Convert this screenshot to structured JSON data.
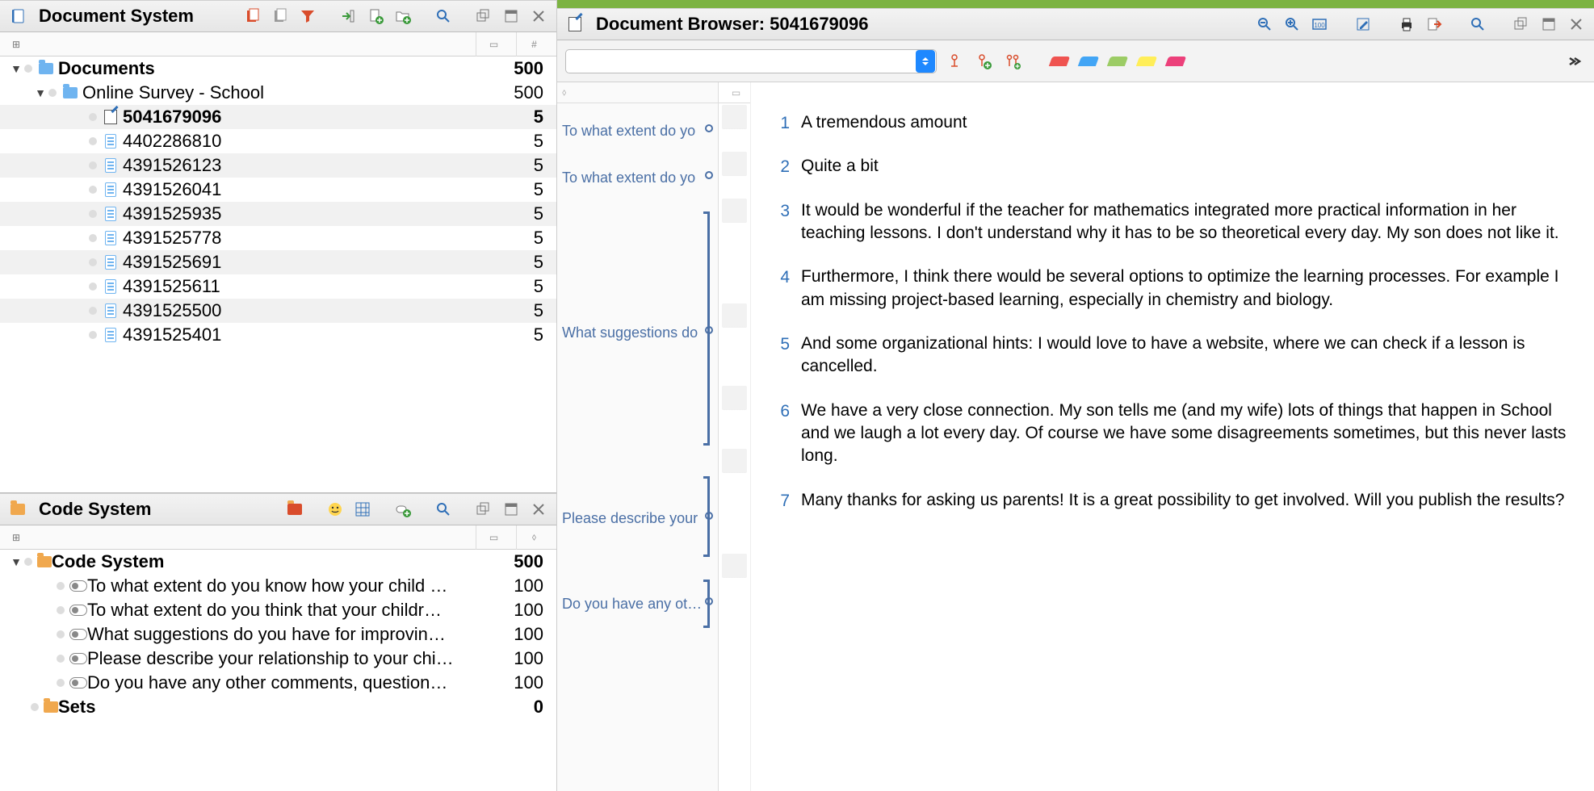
{
  "docSystem": {
    "title": "Document System",
    "root": {
      "label": "Documents",
      "count": "500"
    },
    "folder": {
      "label": "Online Survey - School",
      "count": "500"
    },
    "docs": [
      {
        "id": "5041679096",
        "count": "5",
        "selected": true
      },
      {
        "id": "4402286810",
        "count": "5"
      },
      {
        "id": "4391526123",
        "count": "5"
      },
      {
        "id": "4391526041",
        "count": "5"
      },
      {
        "id": "4391525935",
        "count": "5"
      },
      {
        "id": "4391525778",
        "count": "5"
      },
      {
        "id": "4391525691",
        "count": "5"
      },
      {
        "id": "4391525611",
        "count": "5"
      },
      {
        "id": "4391525500",
        "count": "5"
      },
      {
        "id": "4391525401",
        "count": "5"
      }
    ]
  },
  "codeSystem": {
    "title": "Code System",
    "root": {
      "label": "Code System",
      "count": "500"
    },
    "codes": [
      {
        "label": "To what extent do you know how your child …",
        "count": "100"
      },
      {
        "label": "To what extent do you think that your childr…",
        "count": "100"
      },
      {
        "label": "What suggestions do you have for improvin…",
        "count": "100"
      },
      {
        "label": "Please describe your relationship to your chi…",
        "count": "100"
      },
      {
        "label": "Do you have any other comments, question…",
        "count": "100"
      }
    ],
    "sets": {
      "label": "Sets",
      "count": "0"
    }
  },
  "browser": {
    "title": "Document Browser: 5041679096",
    "stripLabels": [
      "To what extent do yo",
      "To what extent do yo",
      "What suggestions do",
      "Please describe your",
      "Do you have any othe"
    ],
    "paragraphs": [
      {
        "n": "1",
        "text": "A tremendous amount"
      },
      {
        "n": "2",
        "text": "Quite a bit"
      },
      {
        "n": "3",
        "text": "It would be wonderful if the teacher for mathematics integrated more practical information in her teaching lessons. I don't understand why it has to be so theoretical every day. My son does not like it."
      },
      {
        "n": "4",
        "text": "Furthermore, I think there would be several options to optimize the learning processes. For example I am missing project-based learning, especially in chemistry and biology."
      },
      {
        "n": "5",
        "text": "And some organizational hints: I would love to have a website, where we can check if a lesson is cancelled."
      },
      {
        "n": "6",
        "text": "We have a very close connection. My son tells me (and my wife) lots of things that happen in School and we laugh a lot every day. Of course we have some disagreements sometimes, but this never lasts long."
      },
      {
        "n": "7",
        "text": "Many thanks for asking us parents! It is a great possibility to get involved. Will you publish the results?"
      }
    ]
  }
}
